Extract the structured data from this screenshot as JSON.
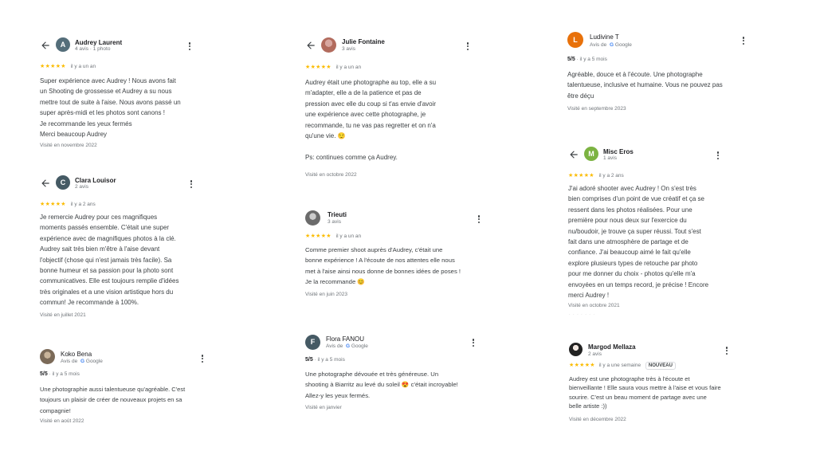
{
  "colors": {
    "star": "#fbbc04",
    "google_blue": "#4285f4",
    "text": "#3c4043",
    "meta": "#70757a"
  },
  "reviews": [
    {
      "name": "Audrey Laurent",
      "meta": "4 avis · 1 photo",
      "avatar_letter": "A",
      "avatar_color": "#546e7a",
      "stars": "★★★★★",
      "time": "il y a un an",
      "text": "Super expérience avec Audrey ! Nous avons fait\nun Shooting de grossesse et Audrey a su nous\nmettre tout de suite à l'aise. Nous avons passé un\nsuper après-midi et les photos sont canons !\nJe recommande les yeux fermés\nMerci beaucoup Audrey",
      "visit": "Visité en novembre 2022"
    },
    {
      "name": "Clara Louisor",
      "meta": "2 avis",
      "avatar_letter": "C",
      "avatar_color": "#455a64",
      "stars": "★★★★★",
      "time": "il y a 2 ans",
      "text": "Je remercie Audrey pour ces magnifiques\nmoments passés ensemble. C'était une super\nexpérience avec de magnifiques photos à la clé.\nAudrey sait très bien m'être à l'aise devant\nl'objectif (chose qui n'est jamais très facile). Sa\nbonne humeur et sa passion pour la photo sont\ncommunicatives. Elle est toujours remplie d'idées\ntrès originales et a une vision artistique hors du\ncommun! Je recommande à 100%.",
      "visit": "Visité en juillet 2021"
    },
    {
      "name": "Koko Bena",
      "meta": "Avis de",
      "google": "Google",
      "score": "5/5",
      "time": "il y a 5 mois",
      "text": "Une photographie aussi talentueuse qu'agréable. C'est\ntoujours un plaisir de créer de nouveaux projets en sa\ncompagnie!",
      "visit": "Visité en août 2022"
    },
    {
      "name": "Julie Fontaine",
      "meta": "3 avis",
      "stars": "★★★★★",
      "time": "il y a un an",
      "text": "Audrey était une photographe au top, elle a su\nm'adapter, elle a de la patience et pas de\npression avec elle du coup si t'as envie d'avoir\nune expérience avec cette photographe, je\nrecommande, tu ne vas pas regretter et on n'a\nqu'une vie. 😌\n\nPs: continues comme ça Audrey.",
      "visit": "Visité en octobre 2022"
    },
    {
      "name": "Trieuti",
      "meta": "3 avis",
      "stars": "★★★★★",
      "time": "il y a un an",
      "text": "Comme premier shoot auprès d'Audrey, c'était une\nbonne expérience ! A l'écoute de nos attentes elle nous\nmet à l'aise ainsi nous donne de bonnes idées de poses !\nJe la recommande 😊",
      "visit": "Visité en juin 2023"
    },
    {
      "name": "Flora FANOU",
      "meta": "Avis de",
      "google": "Google",
      "avatar_letter": "F",
      "avatar_color": "#455a64",
      "score": "5/5",
      "time": "il y a 5 mois",
      "text": "Une photographe dévouée et très généreuse. Un\nshooting à Biarritz au levé du soleil 😍 c'était incroyable!\nAllez-y les yeux fermés.",
      "visit": "Visité en janvier"
    },
    {
      "name": "Ludivine T",
      "meta": "Avis de",
      "google": "Google",
      "avatar_letter": "L",
      "avatar_color": "#e8710a",
      "score": "5/5",
      "time": "il y a 5 mois",
      "text": "Agréable, douce et à l'écoute. Une photographe\ntalentueuse, inclusive et humaine. Vous ne pouvez pas\nêtre déçu",
      "visit": "Visité en septembre 2023"
    },
    {
      "name": "Misc Eros",
      "meta": "1 avis",
      "avatar_letter": "M",
      "avatar_color": "#7cb342",
      "stars": "★★★★★",
      "time": "il y a 2 ans",
      "text": "J'ai adoré shooter avec Audrey ! On s'est très\nbien comprises d'un point de vue créatif et ça se\nressent dans les photos réalisées. Pour une\npremière pour nous deux sur l'exercice du\nnu/boudoir, je trouve ça super réussi. Tout s'est\nfait dans une atmosphère de partage et de\nconfiance. J'ai beaucoup aimé le fait qu'elle\nexplore plusieurs types de retouche par photo\npour me donner du choix - photos qu'elle m'a\nenvoyées en un temps record, je précise ! Encore\nmerci Audrey !",
      "visit": "Visité en octobre 2021"
    },
    {
      "name": "Margod Mellaza",
      "meta": "2 avis",
      "stars": "★★★★★",
      "time": "il y a une semaine",
      "badge": "NOUVEAU",
      "text": "Audrey est une photographe très à l'écoute et\nbienveillante ! Elle saura vous mettre à l'aise et vous faire\nsourire. C'est un beau moment de partage avec une\nbelle artiste :))",
      "visit": "Visité en décembre 2022"
    }
  ]
}
